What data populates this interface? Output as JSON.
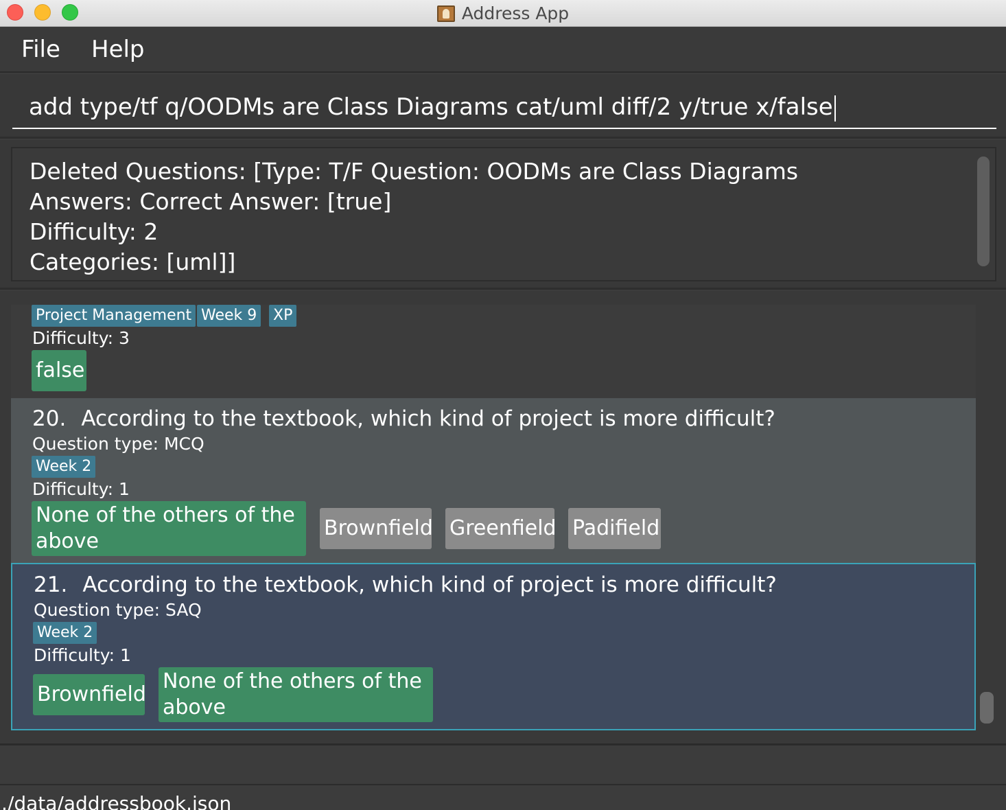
{
  "window": {
    "title": "Address App",
    "colors": {
      "close": "#fc5f57",
      "minimize": "#fdbc2e",
      "zoom": "#33c748"
    }
  },
  "menu": {
    "file": "File",
    "help": "Help"
  },
  "command": {
    "value": "add type/tf q/OODMs are Class Diagrams cat/uml diff/2 y/true x/false"
  },
  "result": {
    "lines": [
      "Deleted Questions: [Type: T/F Question: OODMs are Class Diagrams",
      "Answers: Correct Answer: [true]",
      "Difficulty: 2",
      "Categories: [uml]]"
    ]
  },
  "questions": [
    {
      "tags": [
        "Project Management",
        "Week 9",
        "XP"
      ],
      "difficulty": "Difficulty: 3",
      "options": [
        {
          "text": "false",
          "correct": true
        }
      ]
    },
    {
      "number": "20.",
      "question": "According to the textbook, which kind of project is more difficult?",
      "type": "Question type: MCQ",
      "tags": [
        "Week 2"
      ],
      "difficulty": "Difficulty: 1",
      "options": [
        {
          "text": "None of the others of the above",
          "correct": true
        },
        {
          "text": "Brownfield",
          "correct": false
        },
        {
          "text": "Greenfield",
          "correct": false
        },
        {
          "text": "Padifield",
          "correct": false
        }
      ]
    },
    {
      "number": "21.",
      "question": "According to the textbook, which kind of project is more difficult?",
      "type": "Question type: SAQ",
      "tags": [
        "Week 2"
      ],
      "difficulty": "Difficulty: 1",
      "options": [
        {
          "text": "Brownfield",
          "correct": true
        },
        {
          "text": "None of the others of the above",
          "correct": true
        }
      ]
    }
  ],
  "status": {
    "path": "./data/addressbook.json"
  },
  "colors": {
    "tag": "#3e7b91",
    "correct_option": "#3e8c63",
    "wrong_option": "#8b8b8b",
    "selected_border": "#3aa3b8"
  }
}
